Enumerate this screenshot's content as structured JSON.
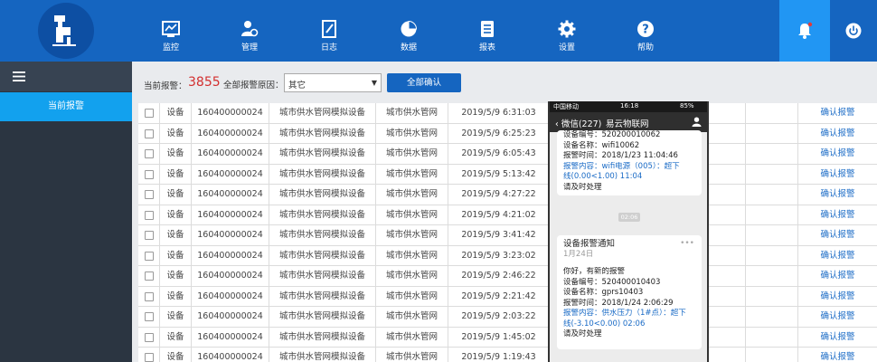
{
  "nav": [
    {
      "label": "监控",
      "icon": "chart-monitor-icon"
    },
    {
      "label": "管理",
      "icon": "user-gear-icon"
    },
    {
      "label": "日志",
      "icon": "log-document-icon"
    },
    {
      "label": "数据",
      "icon": "pie-chart-icon"
    },
    {
      "label": "报表",
      "icon": "report-list-icon"
    },
    {
      "label": "设置",
      "icon": "gear-icon"
    },
    {
      "label": "帮助",
      "icon": "help-question-icon"
    }
  ],
  "colors": {
    "topbar": "#1565c0",
    "bell_bg": "#2196f3",
    "sidebar": "#2b3541",
    "active": "#12a1ee",
    "count": "#d32f2f",
    "link": "#1a6bc6"
  },
  "sidebar": {
    "active_item": "当前报警"
  },
  "toolbar": {
    "current_alarm_label": "当前报警：",
    "alarm_count": "3855",
    "reason_label": "全部报警原因：",
    "reason_value": "其它",
    "confirm_all_label": "全部确认"
  },
  "table": {
    "rows": [
      {
        "type": "设备",
        "id": "160400000024",
        "name": "城市供水管网模拟设备",
        "group": "城市供水管网",
        "time": "2019/5/9 6:31:03",
        "action": "确认报警"
      },
      {
        "type": "设备",
        "id": "160400000024",
        "name": "城市供水管网模拟设备",
        "group": "城市供水管网",
        "time": "2019/5/9 6:25:23",
        "action": "确认报警"
      },
      {
        "type": "设备",
        "id": "160400000024",
        "name": "城市供水管网模拟设备",
        "group": "城市供水管网",
        "time": "2019/5/9 6:05:43",
        "action": "确认报警"
      },
      {
        "type": "设备",
        "id": "160400000024",
        "name": "城市供水管网模拟设备",
        "group": "城市供水管网",
        "time": "2019/5/9 5:13:42",
        "action": "确认报警"
      },
      {
        "type": "设备",
        "id": "160400000024",
        "name": "城市供水管网模拟设备",
        "group": "城市供水管网",
        "time": "2019/5/9 4:27:22",
        "action": "确认报警"
      },
      {
        "type": "设备",
        "id": "160400000024",
        "name": "城市供水管网模拟设备",
        "group": "城市供水管网",
        "time": "2019/5/9 4:21:02",
        "action": "确认报警"
      },
      {
        "type": "设备",
        "id": "160400000024",
        "name": "城市供水管网模拟设备",
        "group": "城市供水管网",
        "time": "2019/5/9 3:41:42",
        "action": "确认报警"
      },
      {
        "type": "设备",
        "id": "160400000024",
        "name": "城市供水管网模拟设备",
        "group": "城市供水管网",
        "time": "2019/5/9 3:23:02",
        "action": "确认报警"
      },
      {
        "type": "设备",
        "id": "160400000024",
        "name": "城市供水管网模拟设备",
        "group": "城市供水管网",
        "time": "2019/5/9 2:46:22",
        "action": "确认报警"
      },
      {
        "type": "设备",
        "id": "160400000024",
        "name": "城市供水管网模拟设备",
        "group": "城市供水管网",
        "time": "2019/5/9 2:21:42",
        "action": "确认报警"
      },
      {
        "type": "设备",
        "id": "160400000024",
        "name": "城市供水管网模拟设备",
        "group": "城市供水管网",
        "time": "2019/5/9 2:03:22",
        "action": "确认报警"
      },
      {
        "type": "设备",
        "id": "160400000024",
        "name": "城市供水管网模拟设备",
        "group": "城市供水管网",
        "time": "2019/5/9 1:45:02",
        "action": "确认报警"
      },
      {
        "type": "设备",
        "id": "160400000024",
        "name": "城市供水管网模拟设备",
        "group": "城市供水管网",
        "time": "2019/5/9 1:19:43",
        "action": "确认报警"
      }
    ]
  },
  "phone": {
    "carrier": "中国移动",
    "time": "16:18",
    "battery": "85%",
    "back_label": "微信(227)",
    "title": "易云物联网",
    "msg1": [
      "设备编号：520200010062",
      "设备名称：wifi10062",
      "报警时间：2018/1/23 11:04:46",
      "报警内容：wifi电源（005）：超下",
      "线(0.00<1.00) 11:04",
      "请及时处理"
    ],
    "timestamp": "02:06",
    "msg2_title": "设备报警通知",
    "msg2_date": "1月24日",
    "msg2_greeting": "你好，有新的报警",
    "msg2": [
      "设备编号：520400010403",
      "设备名称：gprs10403",
      "报警时间：2018/1/24 2:06:29",
      "报警内容：供水压力（1#点）：超下",
      "线(-3.10<0.00) 02:06",
      "请及时处理"
    ]
  }
}
